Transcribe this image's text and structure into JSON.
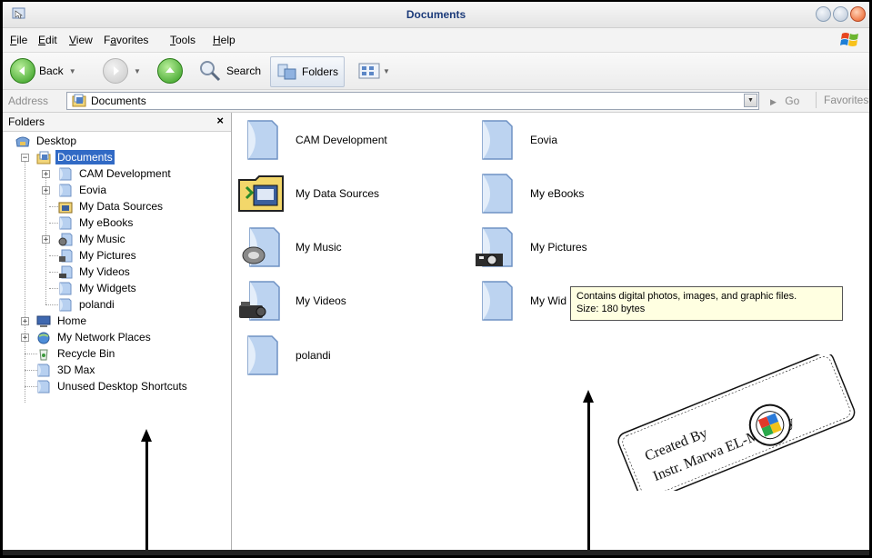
{
  "window": {
    "title": "Documents"
  },
  "menu": [
    {
      "pre": "",
      "u": "F",
      "post": "ile"
    },
    {
      "pre": "",
      "u": "E",
      "post": "dit"
    },
    {
      "pre": "",
      "u": "V",
      "post": "iew"
    },
    {
      "pre": "F",
      "u": "a",
      "post": "vorites"
    },
    {
      "pre": "",
      "u": "T",
      "post": "ools"
    },
    {
      "pre": "",
      "u": "H",
      "post": "elp"
    }
  ],
  "toolbar": {
    "back_label": "Back",
    "search_label": "Search",
    "folders_label": "Folders"
  },
  "address": {
    "label": "Address",
    "value": "Documents",
    "go_label": "Go",
    "favorites_label": "Favorites"
  },
  "folders_pane": {
    "title": "Folders",
    "close": "×",
    "tree": [
      {
        "label": "Desktop"
      },
      {
        "label": "Documents"
      },
      {
        "label": "CAM Development"
      },
      {
        "label": "Eovia"
      },
      {
        "label": "My Data Sources"
      },
      {
        "label": "My eBooks"
      },
      {
        "label": "My Music"
      },
      {
        "label": "My Pictures"
      },
      {
        "label": "My Videos"
      },
      {
        "label": "My Widgets"
      },
      {
        "label": "polandi"
      },
      {
        "label": "Home"
      },
      {
        "label": "My Network Places"
      },
      {
        "label": "Recycle Bin"
      },
      {
        "label": "3D Max"
      },
      {
        "label": "Unused Desktop Shortcuts"
      }
    ]
  },
  "content": {
    "items": [
      {
        "label": "CAM Development"
      },
      {
        "label": "Eovia"
      },
      {
        "label": "My Data Sources"
      },
      {
        "label": "My eBooks"
      },
      {
        "label": "My Music"
      },
      {
        "label": "My Pictures"
      },
      {
        "label": "My Videos"
      },
      {
        "label": "My Wid"
      },
      {
        "label": "polandi"
      }
    ],
    "tooltip": {
      "line1": "Contains digital photos, images, and graphic files.",
      "line2": "Size: 180 bytes"
    }
  },
  "stamp": {
    "line1": "Created By",
    "line2": "Instr. Marwa EL-Magriby"
  },
  "colors": {
    "selection": "#316ac5",
    "title_text": "#1c3b7a",
    "tooltip_bg": "#ffffe1"
  }
}
